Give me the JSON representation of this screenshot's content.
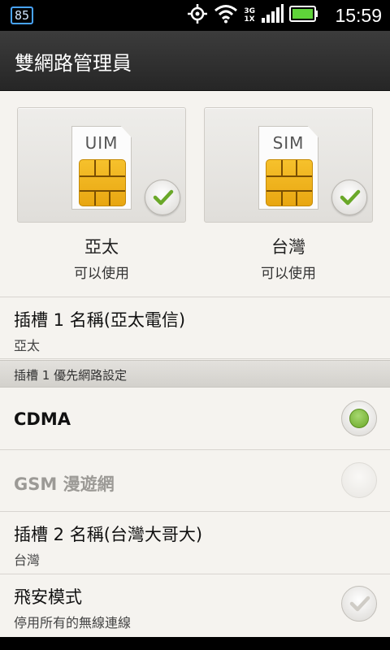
{
  "status_bar": {
    "badge": "85",
    "network_top": "3G",
    "network_bottom": "1X",
    "time": "15:59",
    "icons": [
      "gps-icon",
      "wifi-icon",
      "signal-icon",
      "battery-icon"
    ]
  },
  "title_bar": {
    "title": "雙網路管理員"
  },
  "sims": [
    {
      "card_label": "UIM",
      "name": "亞太",
      "status": "可以使用",
      "checked": true
    },
    {
      "card_label": "SIM",
      "name": "台灣",
      "status": "可以使用",
      "checked": true
    }
  ],
  "settings": {
    "slot1_name": {
      "title": "插槽 1 名稱(亞太電信)",
      "value": "亞太"
    },
    "slot1_pref_header": "插槽 1 優先網路設定",
    "networks": [
      {
        "label": "CDMA",
        "selected": true,
        "enabled": true
      },
      {
        "label": "GSM 漫遊網",
        "selected": false,
        "enabled": false
      }
    ],
    "slot2_name": {
      "title": "插槽 2 名稱(台灣大哥大)",
      "value": "台灣"
    },
    "airplane": {
      "title": "飛安模式",
      "subtitle": "停用所有的無線連線",
      "checked": false
    }
  },
  "colors": {
    "accent_green": "#6aa829",
    "chip_gold": "#f0b41f",
    "badge_blue": "#48a4ff"
  }
}
